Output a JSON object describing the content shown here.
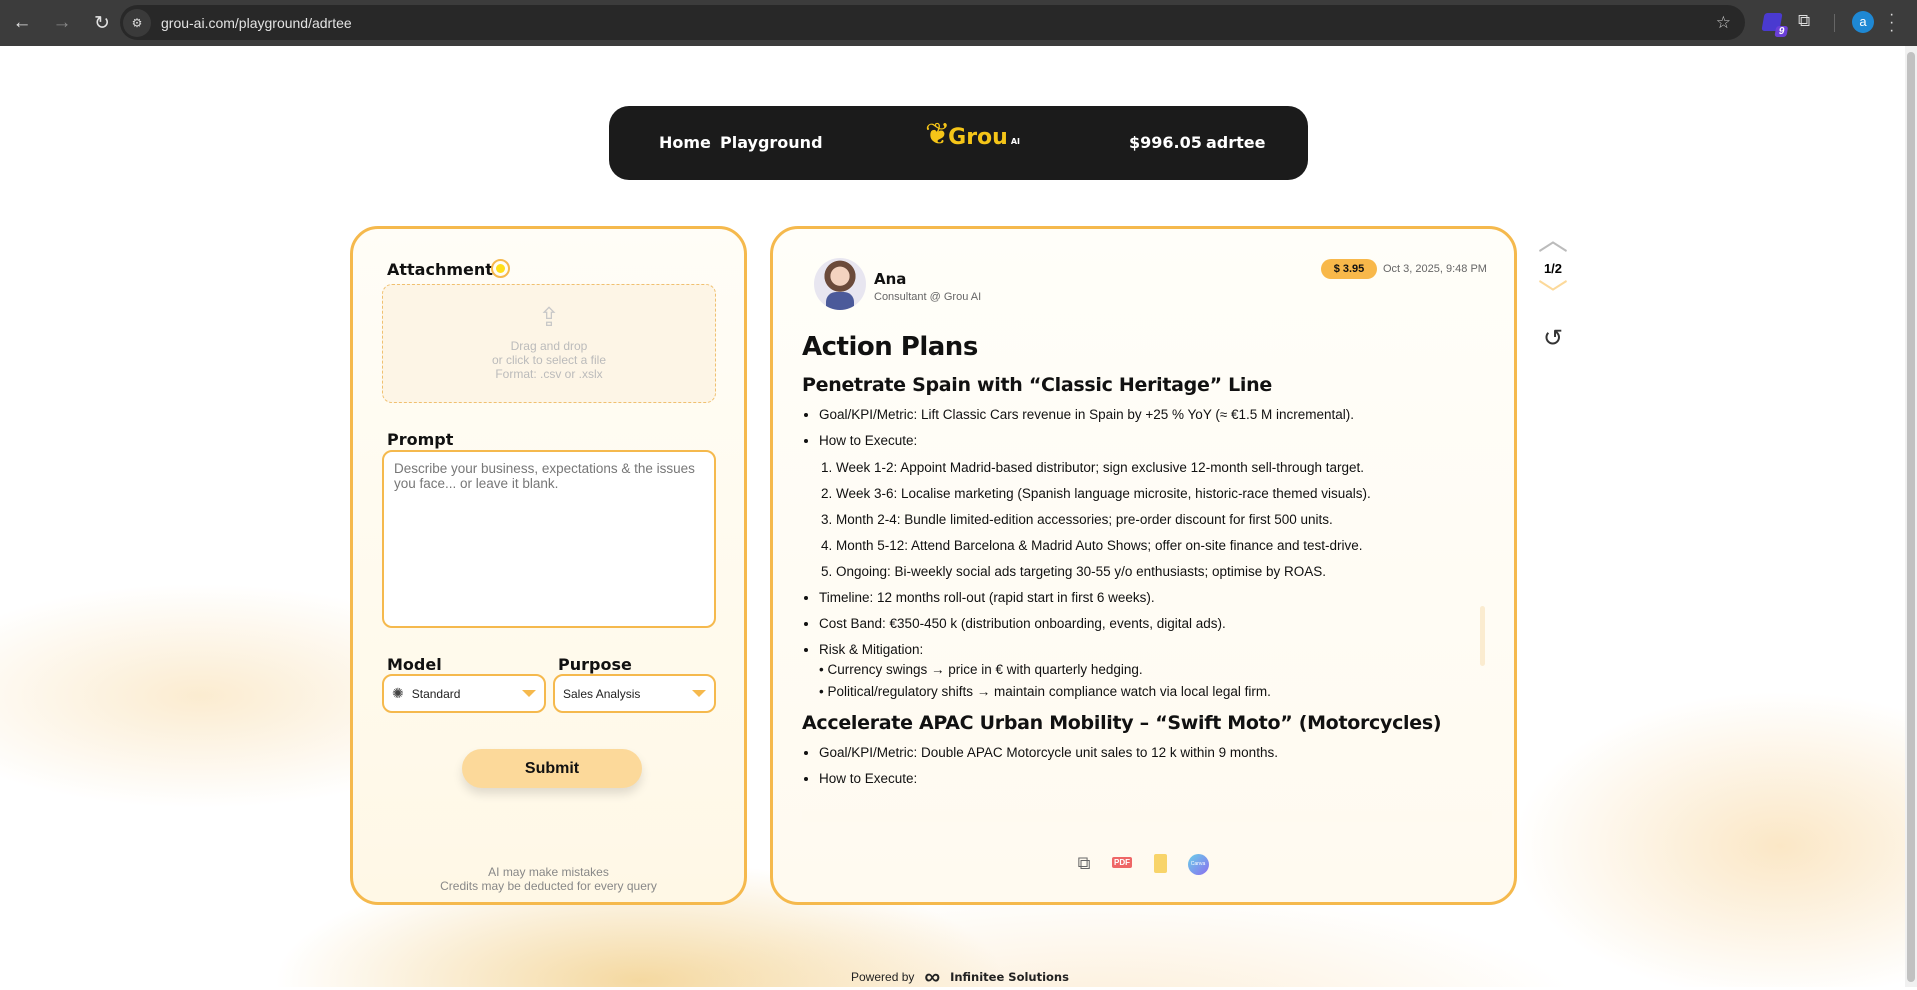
{
  "browser": {
    "url": "grou-ai.com/playground/adrtee",
    "extension_badge": "9",
    "profile_initial": "a"
  },
  "nav": {
    "home": "Home",
    "playground": "Playground",
    "logo_text": "Grou",
    "logo_suffix": "AI",
    "balance": "$996.05",
    "user": "adrtee"
  },
  "form": {
    "attachment_label": "Attachment",
    "drop_line1": "Drag and drop",
    "drop_line2": "or click to select a file",
    "drop_line3": "Format: .csv or .xslx",
    "prompt_label": "Prompt",
    "prompt_placeholder": "Describe your business, expectations & the issues you face... or leave it blank.",
    "prompt_value": "",
    "model_label": "Model",
    "model_value": "Standard",
    "purpose_label": "Purpose",
    "purpose_value": "Sales Analysis",
    "submit": "Submit",
    "note1": "AI may make mistakes",
    "note2": "Credits may be deducted for every query"
  },
  "response": {
    "agent_name": "Ana",
    "agent_role": "Consultant @ Grou AI",
    "cost": "$ 3.95",
    "timestamp": "Oct 3, 2025, 9:48 PM",
    "title": "Action Plans",
    "section1": {
      "heading": "Penetrate Spain with “Classic Heritage” Line",
      "goal": "Goal/KPI/Metric: Lift Classic Cars revenue in Spain by +25 % YoY (≈ €1.5 M incremental).",
      "how": "How to Execute:",
      "steps": [
        "Week 1-2: Appoint Madrid-based distributor; sign exclusive 12-month sell-through target.",
        "Week 3-6: Localise marketing (Spanish language microsite, historic-race themed visuals).",
        "Month 2-4: Bundle limited-edition accessories; pre-order discount for first 500 units.",
        "Month 5-12: Attend Barcelona & Madrid Auto Shows; offer on-site finance and test-drive.",
        "Ongoing: Bi-weekly social ads targeting 30-55 y/o enthusiasts; optimise by ROAS."
      ],
      "timeline": "Timeline: 12 months roll-out (rapid start in first 6 weeks).",
      "cost": "Cost Band: €350-450 k (distribution onboarding, events, digital ads).",
      "risk": "Risk & Mitigation:",
      "risks": [
        "• Currency swings → price in € with quarterly hedging.",
        "• Political/regulatory shifts → maintain compliance watch via local legal firm."
      ]
    },
    "section2": {
      "heading": "Accelerate APAC Urban Mobility – “Swift Moto” (Motorcycles)",
      "goal": "Goal/KPI/Metric: Double APAC Motorcycle unit sales to 12 k within 9 months.",
      "how": "How to Execute:"
    },
    "export_icons": [
      "copy-icon",
      "pdf-icon",
      "slides-icon",
      "canva-icon"
    ],
    "pdf_label": "PDF",
    "canva_label": "Canva"
  },
  "pager": {
    "current": "1/2"
  },
  "footer": {
    "powered_by": "Powered by",
    "company": "Infinitee Solutions"
  },
  "colors": {
    "accent": "#f5b94d",
    "submit": "#fcd99a",
    "logo": "#f5c518",
    "nav_bg": "#1b1b1b"
  }
}
